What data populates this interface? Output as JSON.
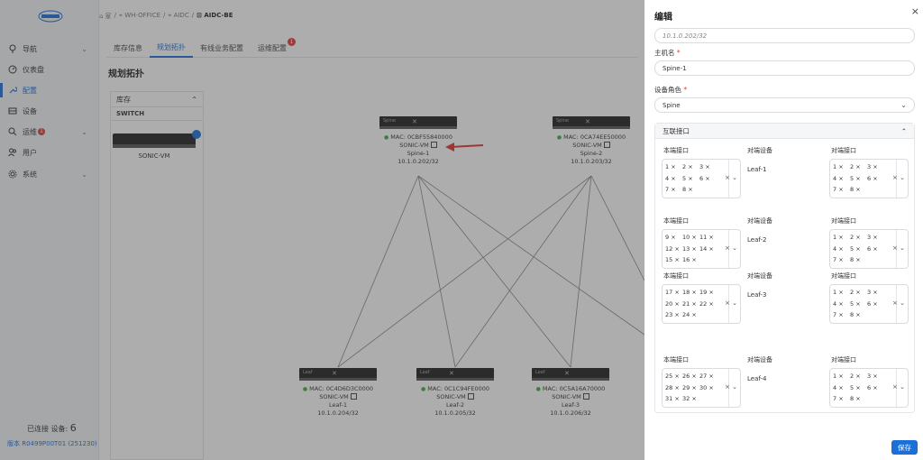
{
  "sidebar": {
    "items": [
      {
        "label": "导航",
        "icon": "compass-icon",
        "chevron": "⌄"
      },
      {
        "label": "仪表盘",
        "icon": "dashboard-icon",
        "chevron": ""
      },
      {
        "label": "配置",
        "icon": "wrench-icon",
        "chevron": ""
      },
      {
        "label": "设备",
        "icon": "device-icon",
        "chevron": ""
      },
      {
        "label": "运维",
        "icon": "search-icon",
        "chevron": "⌄",
        "badge": "1"
      },
      {
        "label": "用户",
        "icon": "users-icon",
        "chevron": ""
      },
      {
        "label": "系统",
        "icon": "gear-icon",
        "chevron": "⌄"
      }
    ],
    "connected_label": "已连接 设备:",
    "connected_count": "6",
    "version": "版本 R0499P00T01 (251230)"
  },
  "breadcrumb": {
    "home": "⌂ 家",
    "sep": "/",
    "office": "⌖ WH-OFFICE",
    "aidc": "⌖ AIDC",
    "current": "⊡ AIDC-BE"
  },
  "tabs": [
    {
      "label": "库存信息"
    },
    {
      "label": "规划拓扑"
    },
    {
      "label": "有线业务配置"
    },
    {
      "label": "运维配置",
      "badge": "1"
    }
  ],
  "page_title": "规划拓扑",
  "inventory": {
    "title": "库存",
    "collapse": "⌃",
    "type": "SWITCH",
    "device_label": "SONIC-VM"
  },
  "nodes": [
    {
      "tag": "Spine",
      "mac": "MAC: 0CBF55840000",
      "model": "SONIC-VM",
      "name": "Spine-1",
      "ip": "10.1.0.202/32"
    },
    {
      "tag": "Spine",
      "mac": "MAC: 0CA74EE50000",
      "model": "SONIC-VM",
      "name": "Spine-2",
      "ip": "10.1.0.203/32"
    },
    {
      "tag": "Leaf",
      "mac": "MAC: 0C4D6D3C0000",
      "model": "SONIC-VM",
      "name": "Leaf-1",
      "ip": "10.1.0.204/32"
    },
    {
      "tag": "Leaf",
      "mac": "MAC: 0C1C94FE0000",
      "model": "SONIC-VM",
      "name": "Leaf-2",
      "ip": "10.1.0.205/32"
    },
    {
      "tag": "Leaf",
      "mac": "MAC: 0C5A16A70000",
      "model": "SONIC-VM",
      "name": "Leaf-3",
      "ip": "10.1.0.206/32"
    }
  ],
  "drawer": {
    "title": "编辑",
    "close": "×",
    "top_field_value": "10.1.0.202/32",
    "hostname_label": "主机名",
    "hostname_value": "Spine-1",
    "role_label": "设备角色",
    "role_value": "Spine",
    "role_caret": "⌄",
    "panel_title": "互联接口",
    "panel_collapse": "⌃",
    "col_local": "本端接口",
    "col_peer_device": "对端设备",
    "col_peer_port": "对端接口",
    "groups": [
      {
        "local": [
          "1 ×",
          "2 ×",
          "3 ×",
          "4 ×",
          "5 ×",
          "6 ×",
          "7 ×",
          "8 ×"
        ],
        "peer": "Leaf-1",
        "remote": [
          "1 ×",
          "2 ×",
          "3 ×",
          "4 ×",
          "5 ×",
          "6 ×",
          "7 ×",
          "8 ×"
        ]
      },
      {
        "local": [
          "9 ×",
          "10 ×",
          "11 ×",
          "12 ×",
          "13 ×",
          "14 ×",
          "15 ×",
          "16 ×"
        ],
        "peer": "Leaf-2",
        "remote": [
          "1 ×",
          "2 ×",
          "3 ×",
          "4 ×",
          "5 ×",
          "6 ×",
          "7 ×",
          "8 ×"
        ]
      },
      {
        "local": [
          "17 ×",
          "18 ×",
          "19 ×",
          "20 ×",
          "21 ×",
          "22 ×",
          "23 ×",
          "24 ×"
        ],
        "peer": "Leaf-3",
        "remote": [
          "1 ×",
          "2 ×",
          "3 ×",
          "4 ×",
          "5 ×",
          "6 ×",
          "7 ×",
          "8 ×"
        ]
      },
      {
        "local": [
          "25 ×",
          "26 ×",
          "27 ×",
          "28 ×",
          "29 ×",
          "30 ×",
          "31 ×",
          "32 ×"
        ],
        "peer": "Leaf-4",
        "remote": [
          "1 ×",
          "2 ×",
          "3 ×",
          "4 ×",
          "5 ×",
          "6 ×",
          "7 ×",
          "8 ×"
        ]
      }
    ],
    "clear_ctl": "× ⌄",
    "save_label": "保存"
  },
  "colors": {
    "accent": "#1d6fd8",
    "badge": "#e23b3b",
    "online": "#3cb043",
    "arrow": "#e8332f"
  }
}
